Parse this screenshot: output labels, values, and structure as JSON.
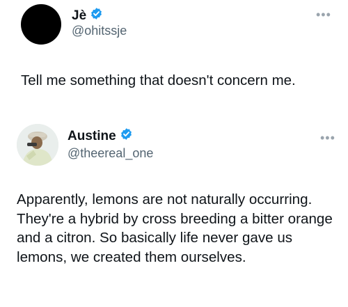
{
  "tweets": [
    {
      "author": {
        "display_name": "Jè",
        "handle": "@ohitssje",
        "verified": true,
        "avatar": "black-circle-avatar"
      },
      "text": "Tell me something that doesn't concern me.",
      "more_icon": "ellipsis-icon"
    },
    {
      "author": {
        "display_name": "Austine",
        "handle": "@theereal_one",
        "verified": true,
        "avatar": "photo-avatar"
      },
      "text": "Apparently, lemons are not naturally occurring. They're a hybrid by cross breeding a bitter orange and a citron. So basically life never gave us lemons, we created them ourselves.",
      "more_icon": "ellipsis-icon"
    }
  ],
  "colors": {
    "text": "#0f1419",
    "secondary": "#536471",
    "verified": "#1d9bf0",
    "background": "#ffffff"
  }
}
